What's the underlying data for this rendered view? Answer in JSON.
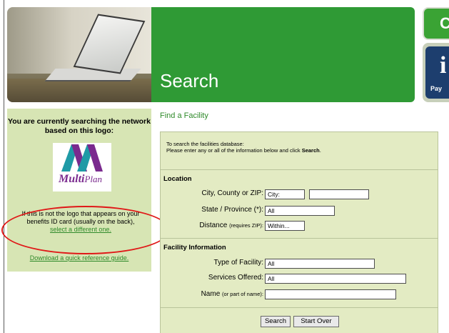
{
  "header": {
    "banner_title": "Search",
    "right_tile_top_letter": "C",
    "right_tile_bottom_glyph": "i",
    "right_tile_bottom_label": "Pay",
    "banner_color": "#2f9a35"
  },
  "left_panel": {
    "heading_line1": "You are currently searching the network",
    "heading_line2": "based on this logo:",
    "logo_text_main": "Multi",
    "logo_text_plan": "Plan",
    "note_line1": "If this is not the logo that appears on your",
    "note_line2": "benefits ID card (usually on the back),",
    "select_link": "select a different one.",
    "guide_link": "Download a quick reference guide."
  },
  "main": {
    "title": "Find a Facility",
    "intro_line1": "To search the facilities database:",
    "intro_line2_prefix": "Please enter any or all of the information below and click ",
    "intro_line2_bold": "Search",
    "intro_line2_suffix": ".",
    "location": {
      "section_label": "Location",
      "city_label": "City, County or ZIP:",
      "city_value": "City:",
      "city_second_value": "",
      "state_label": "State / Province (*):",
      "state_value": "All",
      "distance_label": "Distance",
      "distance_hint": "(requires ZIP):",
      "distance_value": "Within..."
    },
    "facility": {
      "section_label": "Facility Information",
      "type_label": "Type of Facility:",
      "type_value": "All",
      "services_label": "Services Offered:",
      "services_value": "All",
      "name_label": "Name",
      "name_hint": "(or part of name):",
      "name_value": ""
    },
    "buttons": {
      "search": "Search",
      "start_over": "Start Over"
    }
  }
}
